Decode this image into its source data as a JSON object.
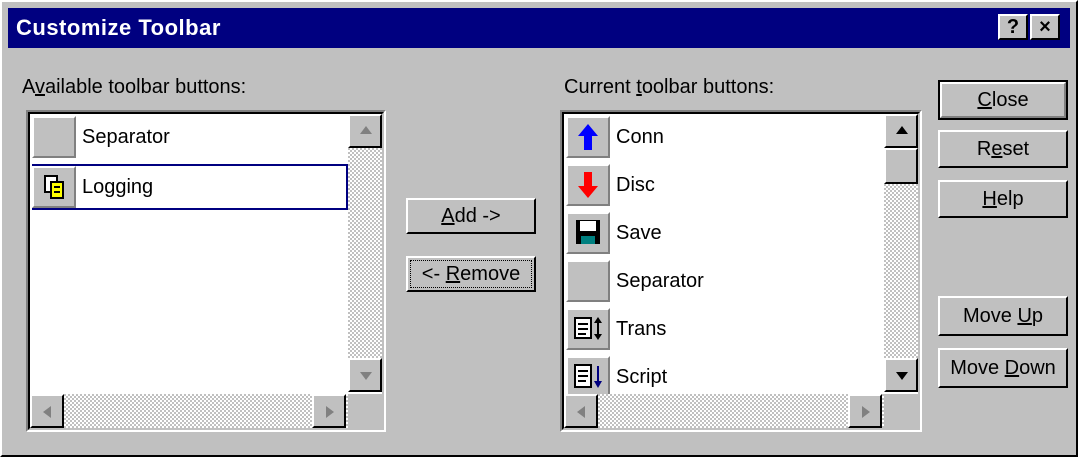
{
  "window": {
    "title": "Customize Toolbar",
    "help_glyph": "?",
    "close_glyph": "×"
  },
  "available": {
    "label_pre": "A",
    "label_u": "v",
    "label_post": "ailable toolbar buttons:",
    "items": [
      {
        "label": "Separator",
        "icon": "blank"
      },
      {
        "label": "Logging",
        "icon": "logging-icon"
      }
    ]
  },
  "current": {
    "label_pre": "Current ",
    "label_u": "t",
    "label_post": "oolbar buttons:",
    "items": [
      {
        "label": "Conn",
        "icon": "blue-up-arrow-icon"
      },
      {
        "label": "Disc",
        "icon": "red-down-arrow-icon"
      },
      {
        "label": "Save",
        "icon": "floppy-disk-icon"
      },
      {
        "label": "Separator",
        "icon": "blank"
      },
      {
        "label": "Trans",
        "icon": "transfer-document-icon"
      },
      {
        "label": "Script",
        "icon": "script-document-icon"
      }
    ]
  },
  "buttons": {
    "add": {
      "u": "A",
      "post": "dd ->"
    },
    "remove": {
      "pre": "<- ",
      "u": "R",
      "post": "emove"
    },
    "close": {
      "u": "C",
      "post": "lose"
    },
    "reset": {
      "pre": "R",
      "u": "e",
      "post": "set"
    },
    "help": {
      "u": "H",
      "post": "elp"
    },
    "move_up": {
      "pre": "Move ",
      "u": "U",
      "post": "p"
    },
    "move_down": {
      "pre": "Move ",
      "u": "D",
      "post": "own"
    }
  },
  "colors": {
    "title_bar": "#000080",
    "face": "#c0c0c0",
    "up_arrow": "#0000ff",
    "down_arrow": "#ff0000"
  }
}
